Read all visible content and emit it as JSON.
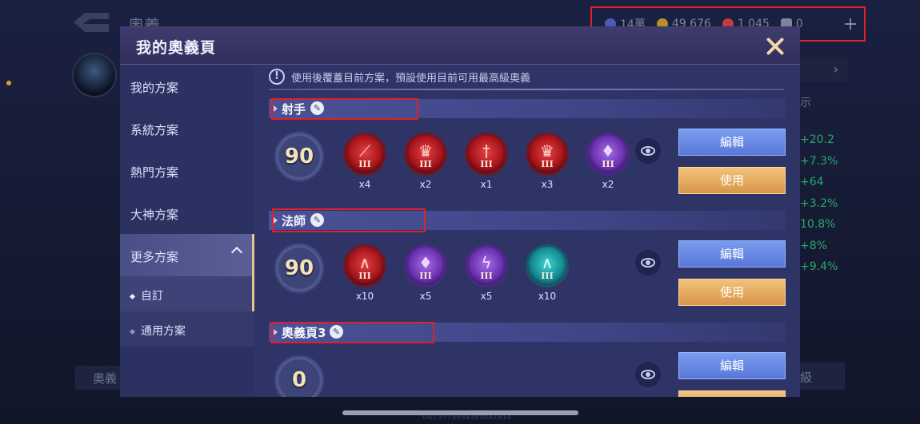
{
  "background": {
    "title": "奧義",
    "currencies": [
      {
        "icon": "diamond-icon",
        "value": "14萬"
      },
      {
        "icon": "gold-coin-icon",
        "value": "49 676"
      },
      {
        "icon": "voucher-icon",
        "value": "1 045"
      },
      {
        "icon": "ticket-icon",
        "value": "0"
      }
    ],
    "plus_label": "+",
    "show_label": "示",
    "stats": [
      "+20.2",
      "+7.3%",
      "+64",
      "+3.2%",
      "10.8%",
      "+8%",
      "+9.4%"
    ],
    "bottom_left": "奧義",
    "bottom_right": "級",
    "uid": "UID:37759343850479​14"
  },
  "modal": {
    "title": "我的奧義頁",
    "notice_icon": "!",
    "notice": "使用後覆蓋目前方案，預設使用目前可用最高級奧義"
  },
  "sidebar": {
    "items": [
      {
        "label": "我的方案"
      },
      {
        "label": "系統方案"
      },
      {
        "label": "熱門方案"
      },
      {
        "label": "大神方案"
      },
      {
        "label": "更多方案"
      }
    ],
    "sub_items": [
      {
        "label": "自訂"
      },
      {
        "label": "通用方案"
      }
    ]
  },
  "pages": [
    {
      "name": "射手",
      "level": "90",
      "runes": [
        {
          "color": "red",
          "glyph": "blade-icon",
          "tier": "III",
          "count": "x4"
        },
        {
          "color": "red",
          "glyph": "crown-icon",
          "tier": "III",
          "count": "x2"
        },
        {
          "color": "red",
          "glyph": "sword-icon",
          "tier": "III",
          "count": "x1"
        },
        {
          "color": "red",
          "glyph": "crown-icon",
          "tier": "III",
          "count": "x3"
        },
        {
          "color": "purple",
          "glyph": "drop-icon",
          "tier": "III",
          "count": "x2"
        }
      ],
      "edit_label": "編輯",
      "use_label": "使用"
    },
    {
      "name": "法師",
      "level": "90",
      "runes": [
        {
          "color": "red",
          "glyph": "arch-icon",
          "tier": "III",
          "count": "x10"
        },
        {
          "color": "purple",
          "glyph": "drop-icon",
          "tier": "III",
          "count": "x5"
        },
        {
          "color": "purple",
          "glyph": "lightning-icon",
          "tier": "III",
          "count": "x5"
        },
        {
          "color": "teal",
          "glyph": "arch-icon",
          "tier": "III",
          "count": "x10"
        }
      ],
      "edit_label": "編輯",
      "use_label": "使用"
    },
    {
      "name": "奧義頁3",
      "level": "0",
      "runes": [],
      "edit_label": "編輯"
    }
  ],
  "colors": {
    "highlight_box": "#e0202c",
    "edit_button": "#6a8ae4",
    "use_button": "#e4ab62"
  }
}
